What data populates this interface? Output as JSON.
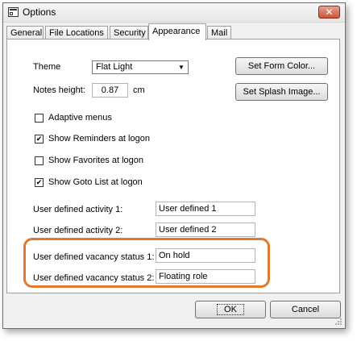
{
  "window": {
    "title": "Options"
  },
  "tabs": [
    "General",
    "File Locations",
    "Security",
    "Appearance",
    "Mail"
  ],
  "appearance": {
    "theme_label": "Theme",
    "theme_value": "Flat Light",
    "notes_height_label": "Notes height:",
    "notes_height_value": "0.87",
    "notes_height_unit": "cm",
    "set_form_color": "Set Form Color...",
    "set_splash_image": "Set Splash Image...",
    "checkboxes": [
      {
        "label": "Adaptive menus",
        "checked": false
      },
      {
        "label": "Show Reminders at logon",
        "checked": true
      },
      {
        "label": "Show Favorites at logon",
        "checked": false
      },
      {
        "label": "Show Goto List at logon",
        "checked": true
      }
    ],
    "fields": [
      {
        "label": "User defined activity 1:",
        "value": "User defined 1"
      },
      {
        "label": "User defined activity 2:",
        "value": "User defined 2"
      },
      {
        "label": "User defined vacancy status 1:",
        "value": "On hold"
      },
      {
        "label": "User defined vacancy status 2:",
        "value": "Floating role"
      }
    ]
  },
  "footer": {
    "ok": "OK",
    "cancel": "Cancel"
  },
  "colors": {
    "highlight": "#e07a2e"
  },
  "icons": {
    "check": "✔",
    "dropdown": "▼",
    "close": "✕"
  }
}
